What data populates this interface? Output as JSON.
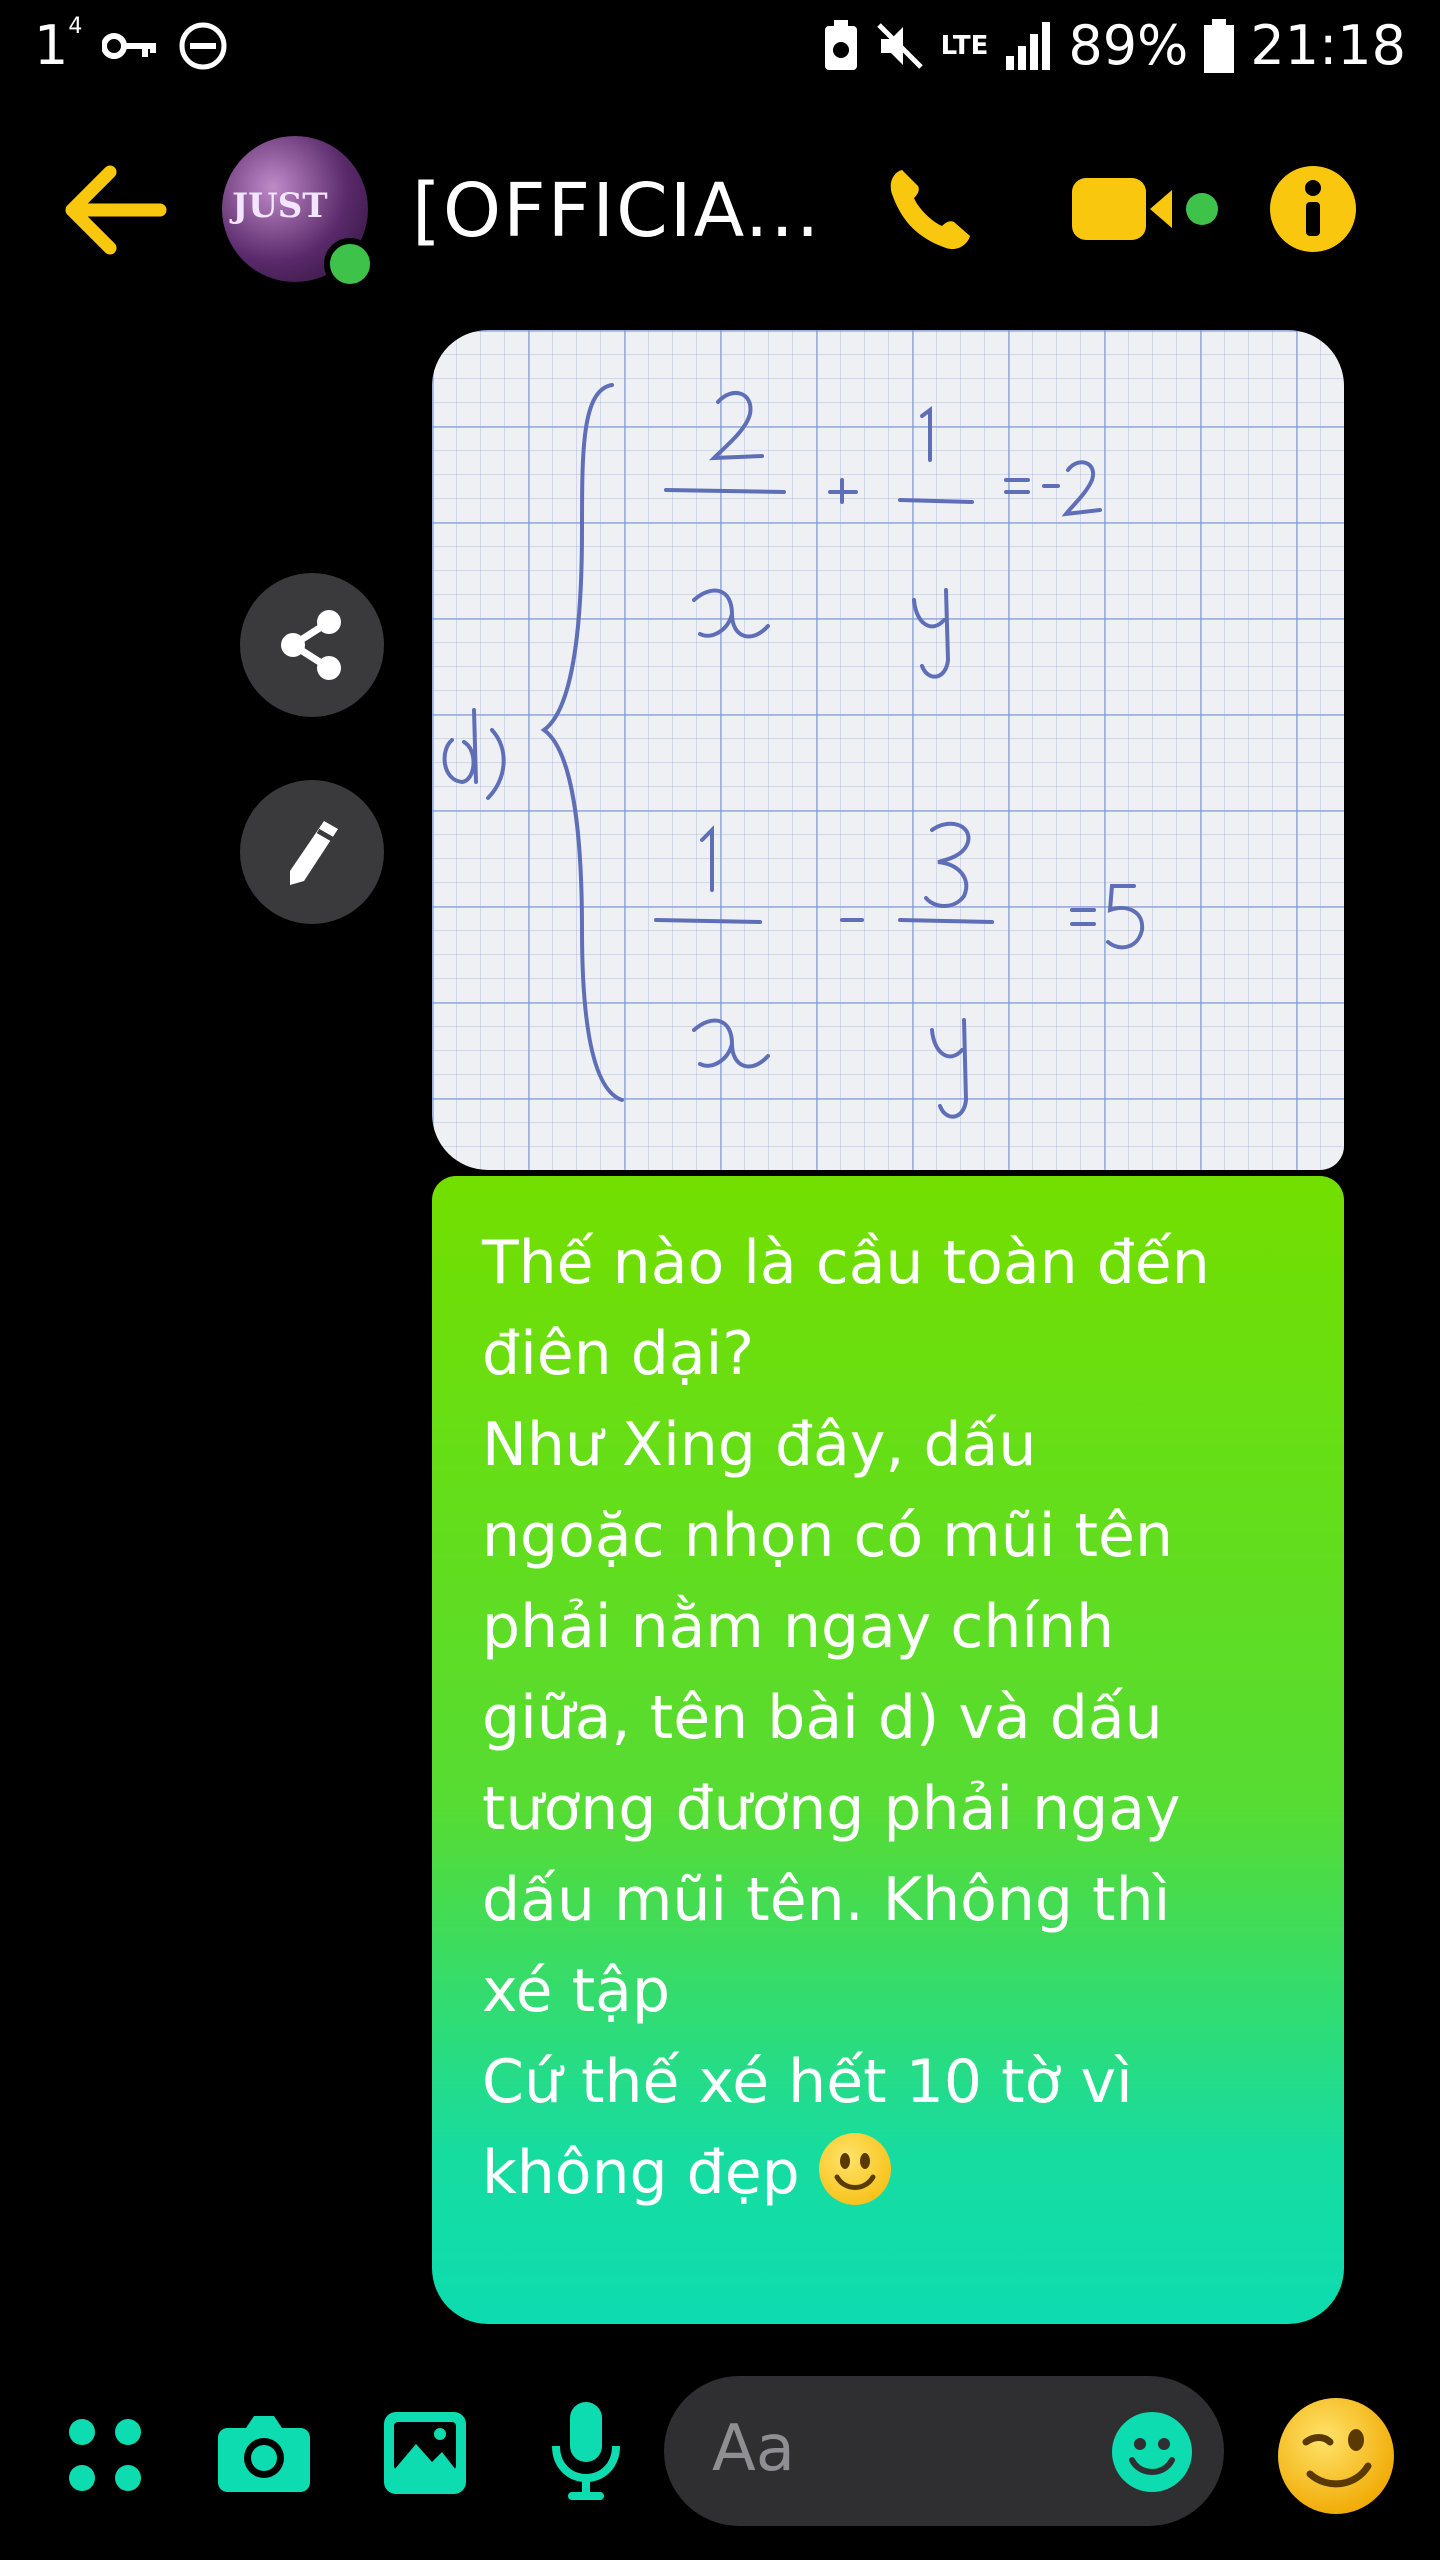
{
  "status_bar": {
    "notif_count": "1",
    "notif_sup": "4",
    "network": "LTE",
    "battery": "89%",
    "time": "21:18"
  },
  "header": {
    "title": "[OFFICIA...",
    "avatar_text": "JUST"
  },
  "image_message": {
    "content": "d) 2/x + 1/y = -2 ; 1/x - 3/y = 5"
  },
  "text_message": {
    "lines": [
      "Thế nào là cầu toàn đến",
      "điên dại?",
      "Như Xing đây, dấu",
      "ngoặc nhọn có mũi tên",
      "phải nằm ngay chính",
      "giữa, tên bài d) và dấu",
      "tương đương phải ngay",
      "dấu mũi tên. Không thì",
      "xé tập",
      "",
      "Cứ thế xé hết 10 tờ vì",
      "không đẹp"
    ]
  },
  "composer": {
    "placeholder": "Aa"
  },
  "colors": {
    "accent_yellow": "#f9c80e",
    "accent_teal": "#0ddcb0",
    "bubble_top": "#73df00",
    "bubble_bottom": "#0ddcb0"
  },
  "icons": [
    "back-arrow-icon",
    "phone-icon",
    "video-icon",
    "info-icon",
    "share-icon",
    "edit-icon",
    "menu-dots-icon",
    "camera-icon",
    "gallery-icon",
    "mic-icon",
    "emoji-icon",
    "wink-emoji-icon"
  ]
}
